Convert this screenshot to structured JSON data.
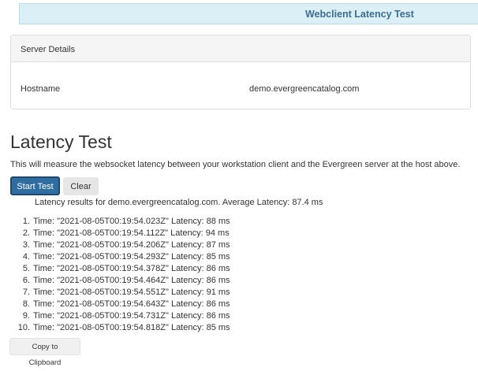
{
  "header": {
    "title": "Webclient Latency Test"
  },
  "server_details": {
    "heading": "Server Details",
    "hostname_label": "Hostname",
    "hostname_value": "demo.evergreencatalog.com"
  },
  "latency_test": {
    "title": "Latency Test",
    "description": "This will measure the websocket latency between your workstation client and the Evergreen server at the host above.",
    "start_button": "Start Test",
    "clear_button": "Clear",
    "summary": "Latency results for demo.evergreencatalog.com. Average Latency: 87.4 ms",
    "results": [
      {
        "num": "1.",
        "text": "Time: \"2021-08-05T00:19:54.023Z\" Latency: 88 ms"
      },
      {
        "num": "2.",
        "text": "Time: \"2021-08-05T00:19:54.112Z\" Latency: 94 ms"
      },
      {
        "num": "3.",
        "text": "Time: \"2021-08-05T00:19:54.206Z\" Latency: 87 ms"
      },
      {
        "num": "4.",
        "text": "Time: \"2021-08-05T00:19:54.293Z\" Latency: 85 ms"
      },
      {
        "num": "5.",
        "text": "Time: \"2021-08-05T00:19:54.378Z\" Latency: 86 ms"
      },
      {
        "num": "6.",
        "text": "Time: \"2021-08-05T00:19:54.464Z\" Latency: 86 ms"
      },
      {
        "num": "7.",
        "text": "Time: \"2021-08-05T00:19:54.551Z\" Latency: 91 ms"
      },
      {
        "num": "8.",
        "text": "Time: \"2021-08-05T00:19:54.643Z\" Latency: 86 ms"
      },
      {
        "num": "9.",
        "text": "Time: \"2021-08-05T00:19:54.731Z\" Latency: 86 ms"
      },
      {
        "num": "10.",
        "text": "Time: \"2021-08-05T00:19:54.818Z\" Latency: 85 ms"
      }
    ],
    "copy_button": "Copy to Clipboard"
  },
  "colors": {
    "title_bar_bg": "#dbeff7",
    "title_text": "#3c6e8f",
    "primary_button": "#2f6da0"
  }
}
